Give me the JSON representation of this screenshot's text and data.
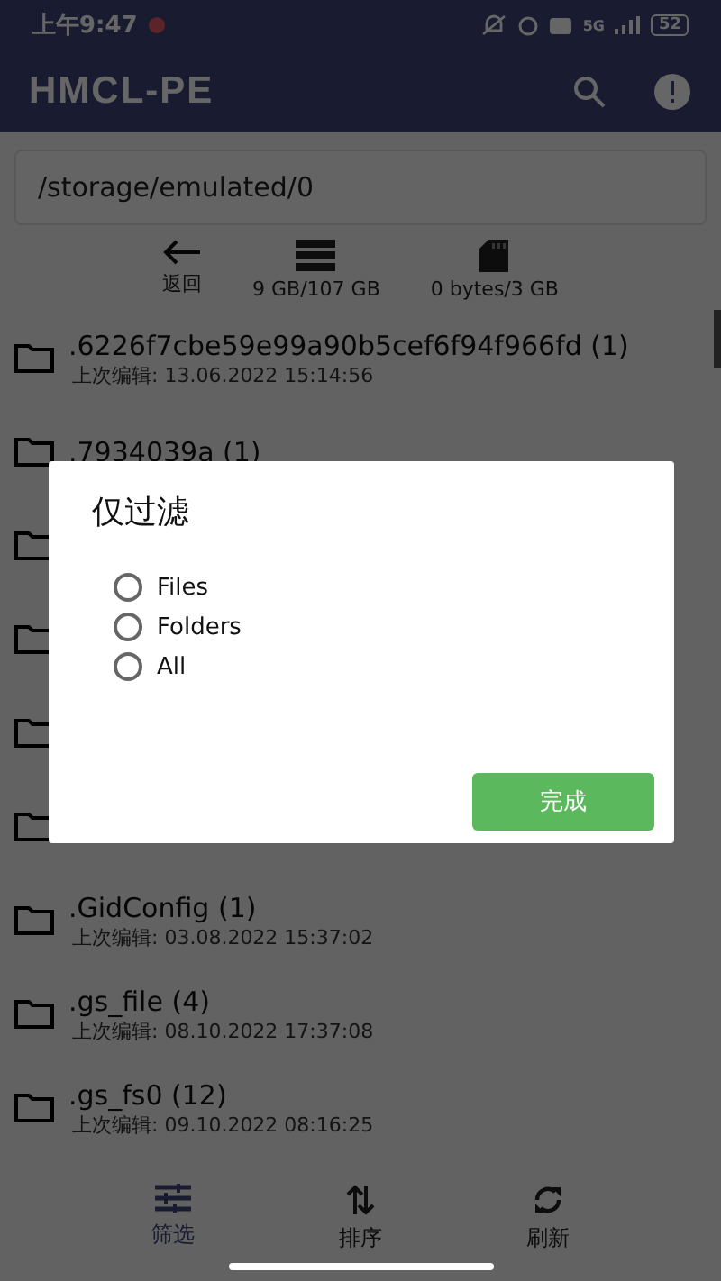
{
  "status_bar": {
    "time": "上午9:47",
    "battery": "52",
    "network": "5G"
  },
  "app_bar": {
    "title": "HMCL-PE"
  },
  "path_field": {
    "value": "/storage/emulated/0"
  },
  "toolbar": [
    {
      "kind": "back",
      "label": "返回"
    },
    {
      "kind": "storage",
      "label": "9 GB/107 GB"
    },
    {
      "kind": "sdcard",
      "label": "0 bytes/3 GB"
    }
  ],
  "files": [
    {
      "kind": "folder",
      "name": ".6226f7cbe59e99a90b5cef6f94f966fd (1)",
      "modified": "上次编辑: 13.06.2022 15:14:56"
    },
    {
      "kind": "folder",
      "name": ".7934039a (1)"
    },
    {
      "kind": "folder"
    },
    {
      "kind": "folder"
    },
    {
      "kind": "folder"
    },
    {
      "kind": "folder"
    },
    {
      "kind": "folder",
      "name": ".GidConfig (1)",
      "modified": "上次编辑: 03.08.2022 15:37:02"
    },
    {
      "kind": "folder",
      "name": ".gs_file (4)",
      "modified": "上次编辑: 08.10.2022 17:37:08"
    },
    {
      "kind": "folder",
      "name": ".gs_fs0 (12)",
      "modified": "上次编辑: 09.10.2022 08:16:25"
    }
  ],
  "dialog": {
    "title": "仅过滤",
    "options": [
      {
        "label": "Files",
        "selected": false
      },
      {
        "label": "Folders",
        "selected": false
      },
      {
        "label": "All",
        "selected": false
      }
    ],
    "button": "完成"
  },
  "bottom_nav": [
    {
      "kind": "filter",
      "label": "筛选",
      "selected": true
    },
    {
      "kind": "sort",
      "label": "排序",
      "selected": false
    },
    {
      "kind": "refresh",
      "label": "刷新",
      "selected": false
    }
  ]
}
